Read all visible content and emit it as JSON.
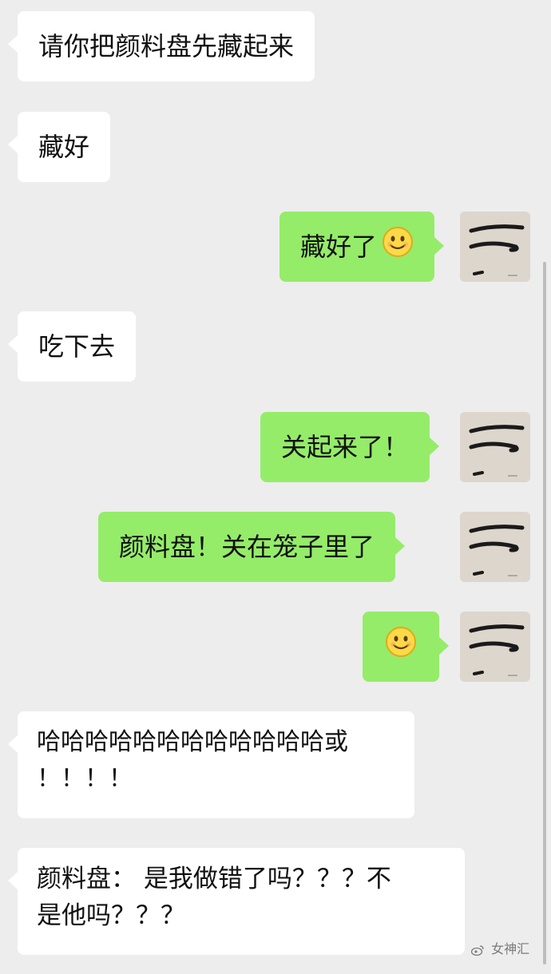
{
  "messages": [
    {
      "side": "in",
      "text": "请你把颜料盘先藏起来"
    },
    {
      "side": "in",
      "text": "藏好"
    },
    {
      "side": "out",
      "text": "藏好了",
      "emoji": "smile-emoji"
    },
    {
      "side": "in",
      "text": "吃下去"
    },
    {
      "side": "out",
      "text": "关起来了！"
    },
    {
      "side": "out",
      "text": "颜料盘！关在笼子里了"
    },
    {
      "side": "out",
      "text": "",
      "emoji": "smile-emoji"
    },
    {
      "side": "in",
      "line1": "哈哈哈哈哈哈哈哈哈哈哈哈或",
      "line2": "！！！！"
    },
    {
      "side": "in",
      "line1": "颜料盘： 是我做错了吗？？？不",
      "line2": "是他吗？？？"
    }
  ],
  "avatar": {
    "icon": "scribble-avatar-icon"
  },
  "watermark": {
    "text": "女神汇",
    "icon": "weibo-icon"
  },
  "colors": {
    "background": "#ededed",
    "incoming_bubble": "#ffffff",
    "outgoing_bubble": "#95ec69",
    "text": "#111111"
  }
}
